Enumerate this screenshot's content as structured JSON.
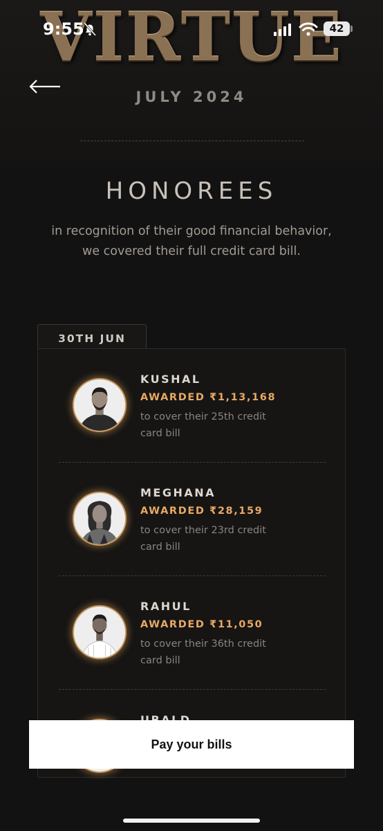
{
  "status_bar": {
    "time": "9:55",
    "battery": "42"
  },
  "brand": "VIRTUE",
  "month": "JULY 2024",
  "section": {
    "title": "HONOREES",
    "subtitle": "in recognition of their good financial behavior, we covered their full credit card bill."
  },
  "date_tab": "30TH JUN",
  "honorees": [
    {
      "name": "KUSHAL",
      "award": "AWARDED ₹1,13,168",
      "desc": "to cover their 25th credit card bill"
    },
    {
      "name": "MEGHANA",
      "award": "AWARDED ₹28,159",
      "desc": "to cover their 23rd credit card bill"
    },
    {
      "name": "RAHUL",
      "award": "AWARDED ₹11,050",
      "desc": "to cover their 36th credit card bill"
    },
    {
      "name": "UBALD",
      "award": "",
      "desc": ""
    }
  ],
  "cta": "Pay your bills",
  "colors": {
    "accent": "#e8a865",
    "background": "#131212",
    "button_bg": "#ffffff"
  }
}
